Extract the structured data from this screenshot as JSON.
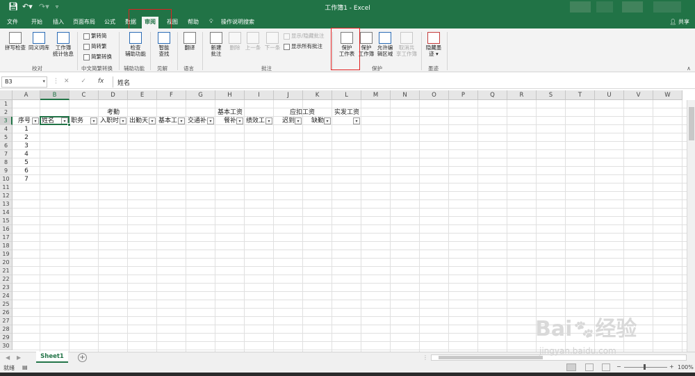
{
  "window": {
    "title": "工作簿1 - Excel",
    "share_label": "共享"
  },
  "tabs": [
    "文件",
    "开始",
    "插入",
    "页面布局",
    "公式",
    "数据",
    "审阅",
    "视图",
    "帮助"
  ],
  "active_tab": "审阅",
  "tell_me": "操作说明搜索",
  "ribbon": {
    "spelling": "拼写检查",
    "thesaurus": "同义词库",
    "workbook_stats_1": "工作簿",
    "workbook_stats_2": "统计信息",
    "proofing_group": "校对",
    "to_traditional": "繁转简",
    "to_simplified": "简转繁",
    "convert": "简繁转换",
    "chinese_group": "中文简繁转换",
    "check_access_1": "检查",
    "check_access_2": "辅助功能",
    "access_group": "辅助功能",
    "smart_lookup_1": "智能",
    "smart_lookup_2": "查找",
    "insights_group": "见解",
    "translate": "翻译",
    "language_group": "语言",
    "new_comment_1": "新建",
    "new_comment_2": "批注",
    "delete": "删除",
    "previous": "上一条",
    "next": "下一条",
    "show_hide_comment": "显示/隐藏批注",
    "show_all_comments": "显示所有批注",
    "comments_group": "批注",
    "protect_sheet_1": "保护",
    "protect_sheet_2": "工作表",
    "protect_workbook_1": "保护",
    "protect_workbook_2": "工作簿",
    "allow_edit_1": "允许编",
    "allow_edit_2": "辑区域",
    "unshare_1": "取消共",
    "unshare_2": "享工作簿",
    "protect_group": "保护",
    "hide_ink_1": "隐藏墨",
    "hide_ink_2": "迹 ▾",
    "ink_group": "墨迹"
  },
  "formula_bar": {
    "name_box": "B3",
    "content": "姓名",
    "fx": "fx"
  },
  "columns": [
    "A",
    "B",
    "C",
    "D",
    "E",
    "F",
    "G",
    "H",
    "I",
    "J",
    "K",
    "L",
    "M",
    "N",
    "O",
    "P",
    "Q",
    "R",
    "S",
    "T",
    "U",
    "V",
    "W"
  ],
  "rows": [
    "1",
    "2",
    "3",
    "4",
    "5",
    "6",
    "7",
    "8",
    "9",
    "10",
    "11",
    "12",
    "13",
    "14",
    "15",
    "16",
    "17",
    "18",
    "19",
    "20",
    "21",
    "22",
    "23",
    "24",
    "25",
    "26",
    "27",
    "28",
    "29",
    "30"
  ],
  "cells": {
    "D2": "考勤",
    "H2": "基本工资",
    "K2": "应扣工资",
    "L2": "实发工资",
    "A3": "序号",
    "B3": "姓名",
    "C3": "职务",
    "D3": "入职时",
    "E3": "出勤天",
    "F3": "基本工",
    "G3": "交通补",
    "H3": "餐补",
    "I3": "绩效工",
    "J3": "迟到",
    "K3": "缺勤",
    "A4": "1",
    "A5": "2",
    "A6": "3",
    "A7": "4",
    "A8": "5",
    "A9": "6",
    "A10": "7"
  },
  "sheet_tab": "Sheet1",
  "status": {
    "ready": "就绪",
    "zoom": "100%"
  },
  "watermark": {
    "brand": "Bai",
    "brand2": "经验",
    "url": "jingyan.baidu.com"
  }
}
